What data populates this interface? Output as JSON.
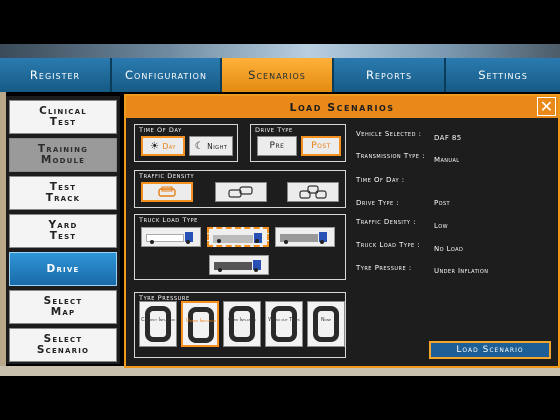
{
  "nav": {
    "tabs": [
      {
        "label": "Register"
      },
      {
        "label": "Configuration"
      },
      {
        "label": "Scenarios"
      },
      {
        "label": "Reports"
      },
      {
        "label": "Settings"
      }
    ],
    "active_tab": "Scenarios"
  },
  "sidebar": {
    "items": [
      {
        "label": "Clinical Test"
      },
      {
        "label": "Training Module"
      },
      {
        "label": "Test Track"
      },
      {
        "label": "Yard Test"
      },
      {
        "label": "Drive"
      },
      {
        "label": "Select Map"
      },
      {
        "label": "Select Scenario"
      }
    ],
    "active_item": "Drive"
  },
  "panel": {
    "title": "Load Scenarios",
    "close_icon": "close-icon",
    "time_of_day": {
      "title": "Time Of Day",
      "day": "Day",
      "night": "Night",
      "selected": "Day"
    },
    "drive_type": {
      "title": "Drive Type",
      "pre": "Pre",
      "post": "Post",
      "selected": "Post"
    },
    "traffic_density": {
      "title": "Traffic Density",
      "options": [
        "low-traffic-icon",
        "medium-traffic-icon",
        "high-traffic-icon"
      ],
      "selected": 0
    },
    "truck_load": {
      "title": "Truck Load Type",
      "options": [
        "no-load-truck",
        "low-load-truck",
        "medium-load-truck",
        "high-load-truck"
      ],
      "selected": 1
    },
    "tyre_pressure": {
      "title": "Tyre Pressure",
      "options": [
        "Correct Inflation",
        "Under Inflation",
        "Over Inflation",
        "Worn out Tyres",
        "None"
      ],
      "selected": 1
    },
    "summary": [
      {
        "label": "Vehicle Selected :",
        "value": "DAF 85"
      },
      {
        "label": "Transmission Type :",
        "value": "Manual"
      },
      {
        "label": "Time Of Day :",
        "value": ""
      },
      {
        "label": "Drive Type :",
        "value": "Post"
      },
      {
        "label": "Traffic Density :",
        "value": "Low"
      },
      {
        "label": "Truck Load Type :",
        "value": "No Load"
      },
      {
        "label": "Tyre Pressure :",
        "value": "Under Inflation"
      }
    ],
    "load_button": "Load Scenario"
  },
  "colors": {
    "accent_orange": "#e8891a",
    "nav_blue": "#1d5d86",
    "button_blue": "#1b5f96"
  }
}
